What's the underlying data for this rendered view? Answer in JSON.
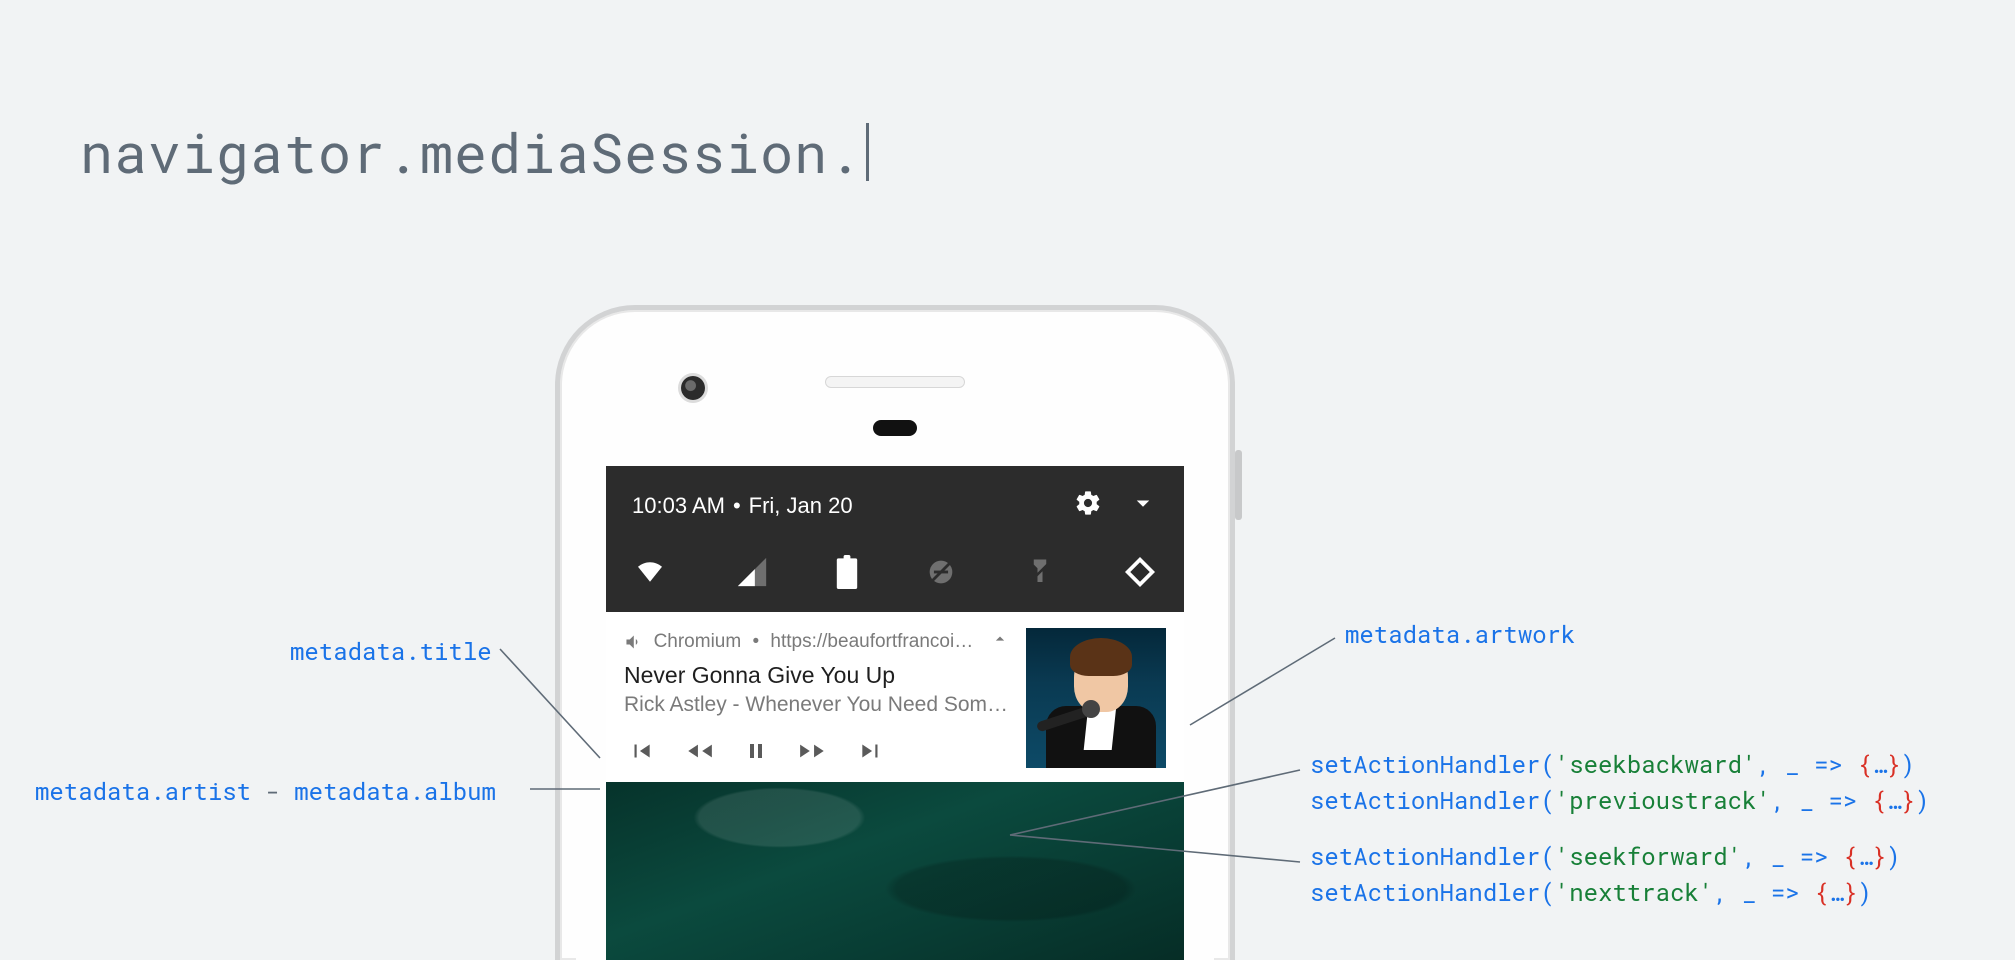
{
  "heading": "navigator.mediaSession.",
  "phone": {
    "statusbar": {
      "time": "10:03 AM",
      "dot": "•",
      "date": "Fri, Jan 20"
    },
    "notification": {
      "app": "Chromium",
      "origin_dot": "•",
      "origin": "https://beaufortfrancois.githu..",
      "title": "Never Gonna Give You Up",
      "artist": "Rick Astley",
      "sep": " - ",
      "album": "Whenever You Need Somebo.."
    }
  },
  "labels": {
    "metadata_title": "metadata.title",
    "metadata_artist": "metadata.artist",
    "metadata_album": "metadata.album",
    "dash": " - ",
    "metadata_artwork": "metadata.artwork"
  },
  "handlers_top": [
    {
      "fn": "setActionHandler",
      "arg": "seekbackward"
    },
    {
      "fn": "setActionHandler",
      "arg": "previoustrack"
    }
  ],
  "handlers_bottom": [
    {
      "fn": "setActionHandler",
      "arg": "seekforward"
    },
    {
      "fn": "setActionHandler",
      "arg": "nexttrack"
    }
  ],
  "handler_suffix": {
    "open": "(",
    "q": "'",
    "comma": ", ",
    "lambda": "_ => ",
    "lb": "{",
    "dots": "…",
    "rb": "}",
    "close": ")"
  },
  "colors": {
    "link": "#1a73e8",
    "string": "#188038",
    "brace": "#d93025",
    "body": "#5f6b77"
  }
}
